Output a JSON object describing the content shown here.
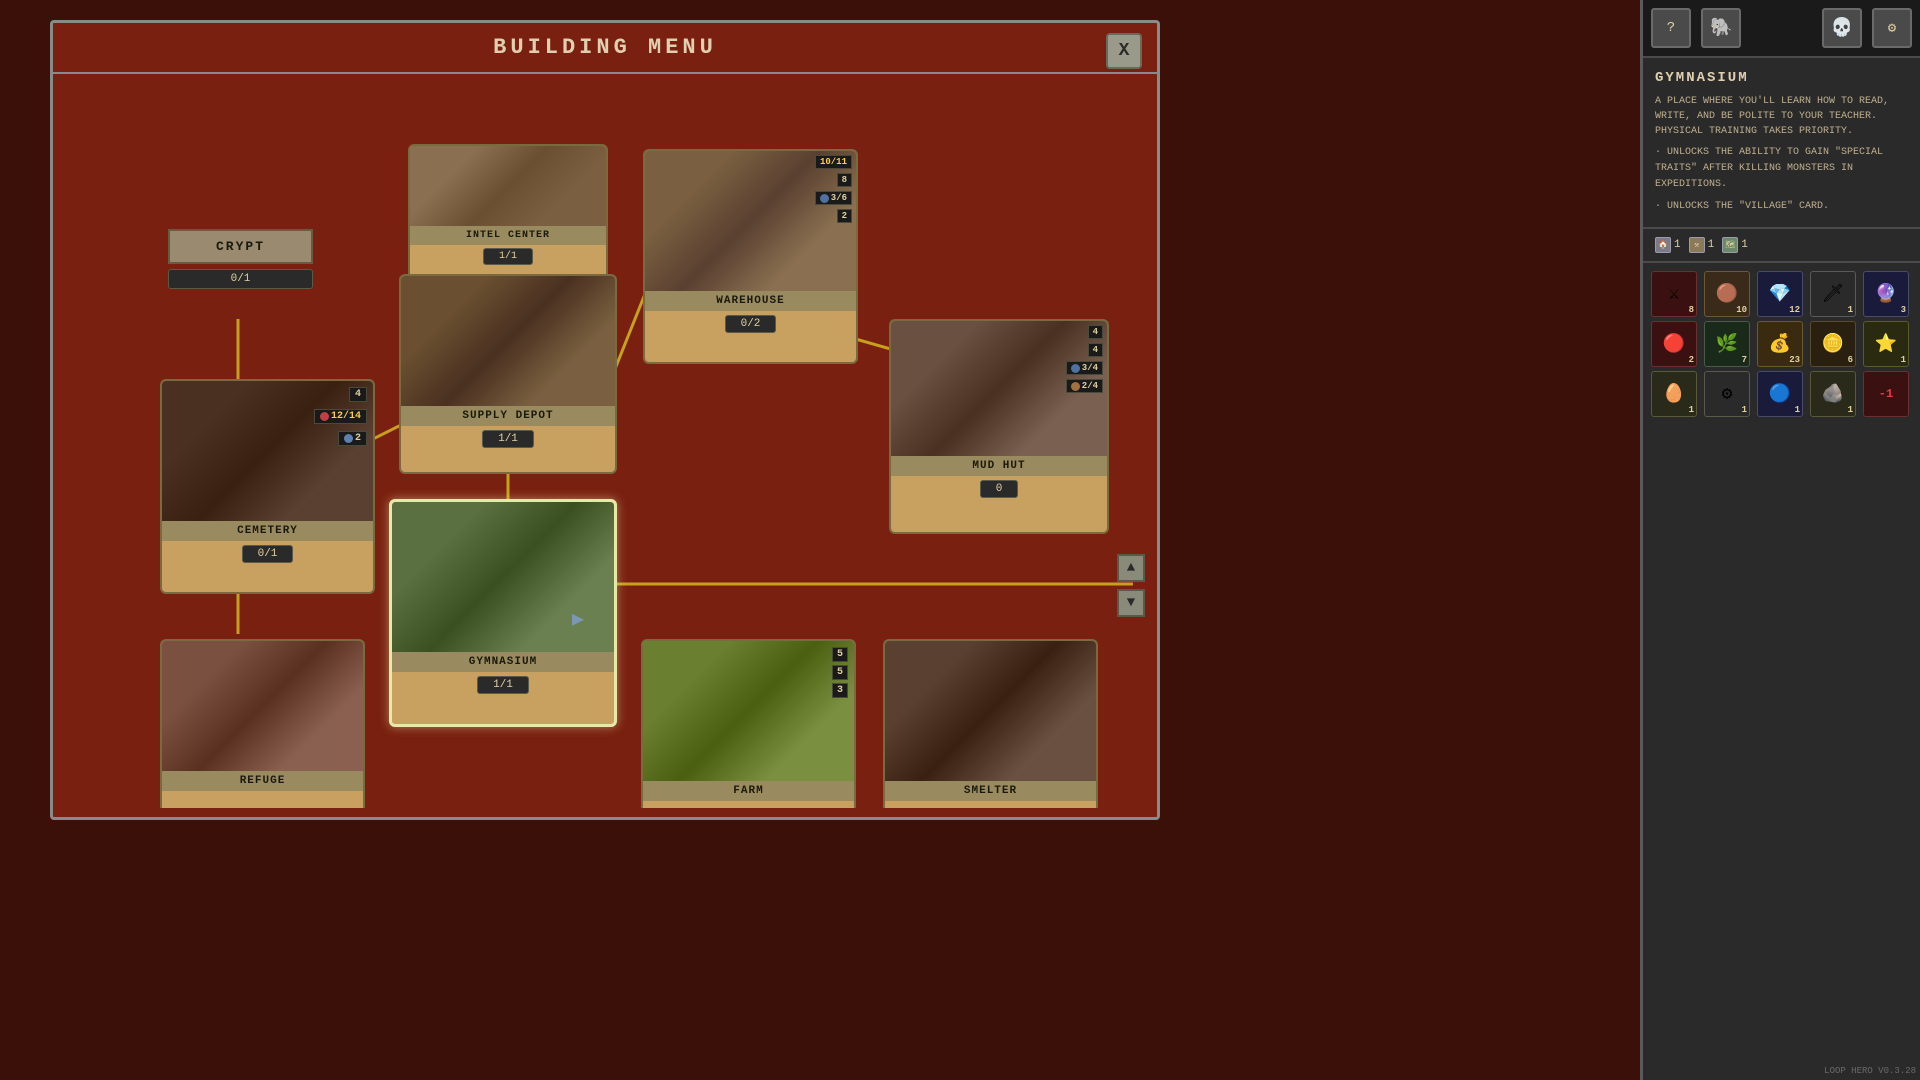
{
  "window": {
    "title": "BUILDING MENU",
    "close_btn": "X"
  },
  "buildings": {
    "crypt": {
      "name": "CRYPT",
      "counter": "0/1",
      "id": "crypt"
    },
    "cemetery": {
      "name": "CEMETERY",
      "counter": "0/1",
      "resources": [
        {
          "icon": "🪨",
          "value": "4"
        },
        {
          "icon": "💀",
          "value": "12/14"
        },
        {
          "icon": "💧",
          "value": "2"
        }
      ],
      "id": "cemetery"
    },
    "intel_center": {
      "name": "INTEL CENTER",
      "counter": "1/1",
      "id": "intel_center"
    },
    "supply_depot": {
      "name": "SUPPLY DEPOT",
      "counter": "1/1",
      "id": "supply_depot"
    },
    "warehouse": {
      "name": "WAREHOUSE",
      "counter": "0/2",
      "resources": [
        {
          "icon": "📦",
          "value": "10/11"
        },
        {
          "icon": "🪨",
          "value": "8"
        },
        {
          "icon": "🔵",
          "value": "3/6"
        },
        {
          "icon": "💛",
          "value": "2"
        }
      ],
      "id": "warehouse"
    },
    "mud_hut": {
      "name": "MUD HUT",
      "counter": "0",
      "resources": [
        {
          "icon": "🟡",
          "value": "4"
        },
        {
          "icon": "🪨",
          "value": "4"
        },
        {
          "icon": "🔵",
          "value": "3/4"
        },
        {
          "icon": "🟤",
          "value": "2/4"
        }
      ],
      "id": "mud_hut"
    },
    "gymnasium": {
      "name": "GYMNASIUM",
      "counter": "1/1",
      "id": "gymnasium"
    },
    "refuge": {
      "name": "REFUGE",
      "id": "refuge"
    },
    "farm": {
      "name": "FARM",
      "resources": [
        {
          "icon": "🌿",
          "value": "5"
        },
        {
          "icon": "💧",
          "value": "5"
        },
        {
          "icon": "🪨",
          "value": "3"
        }
      ],
      "id": "farm"
    },
    "smelter": {
      "name": "SMELTER",
      "id": "smelter"
    }
  },
  "info_panel": {
    "building_name": "GYMNASIUM",
    "description": "A PLACE WHERE YOU'LL LEARN HOW TO READ, WRITE, AND BE POLITE TO YOUR TEACHER. PHYSICAL TRAINING TAKES PRIORITY.",
    "bullets": [
      "· UNLOCKS THE ABILITY TO GAIN \"SPECIAL TRAITS\" AFTER KILLING MONSTERS IN EXPEDITIONS.",
      "· UNLOCKS THE \"VILLAGE\" CARD."
    ]
  },
  "top_icons": [
    {
      "label": "help",
      "icon": "?"
    },
    {
      "label": "creature",
      "icon": "🐘"
    },
    {
      "label": "skull",
      "icon": "💀"
    },
    {
      "label": "settings",
      "icon": "⚙"
    }
  ],
  "resource_slots": [
    {
      "icon": "🏠",
      "count": "1"
    },
    {
      "icon": "⚒",
      "count": "1"
    },
    {
      "icon": "🗺",
      "count": "1"
    }
  ],
  "resource_inventory": [
    {
      "icon": "⚔",
      "count": "8",
      "color": "#c04040"
    },
    {
      "icon": "🟤",
      "count": "10",
      "color": "#8a6040"
    },
    {
      "icon": "💎",
      "count": "12",
      "color": "#8080c0"
    },
    {
      "icon": "🗡",
      "count": "1",
      "color": "#a0a0a0"
    },
    {
      "icon": "🔮",
      "count": "3",
      "color": "#6060a0"
    },
    {
      "icon": "🔴",
      "count": "2",
      "color": "#c04040"
    },
    {
      "icon": "🌿",
      "count": "7",
      "color": "#406040"
    },
    {
      "icon": "💰",
      "count": "23",
      "color": "#c0a040"
    },
    {
      "icon": "🪙",
      "count": "6",
      "color": "#a08030"
    },
    {
      "icon": "⭐",
      "count": "1",
      "color": "#c0c040"
    },
    {
      "icon": "🥚",
      "count": "1",
      "color": "#c0b080"
    },
    {
      "icon": "⚙",
      "count": "1",
      "color": "#808080"
    },
    {
      "icon": "🔵",
      "count": "1",
      "color": "#4060a0"
    },
    {
      "icon": "🪨",
      "count": "1",
      "color": "#808070"
    },
    {
      "icon": "-1",
      "count": "",
      "color": "#c04040"
    }
  ],
  "version": "LOOP HERO V0.3.28"
}
